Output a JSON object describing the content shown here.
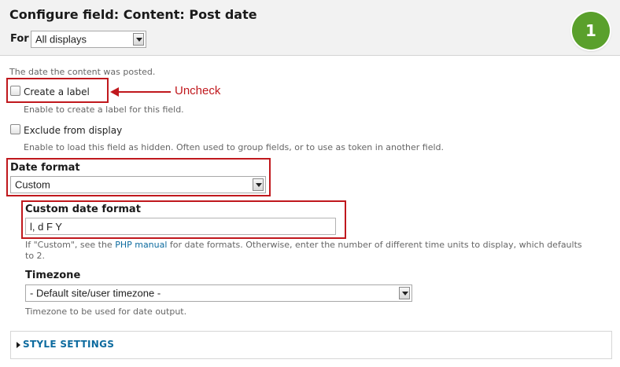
{
  "header": {
    "title": "Configure field: Content: Post date",
    "for_label": "For",
    "for_select_value": "All displays",
    "step_badge": "1"
  },
  "field": {
    "description": "The date the content was posted.",
    "create_label": {
      "label": "Create a label",
      "checked": false,
      "help": "Enable to create a label for this field."
    },
    "exclude": {
      "label": "Exclude from display",
      "checked": false,
      "help": "Enable to load this field as hidden. Often used to group fields, or to use as token in another field."
    },
    "date_format": {
      "label": "Date format",
      "value": "Custom"
    },
    "custom_date_format": {
      "label": "Custom date format",
      "value": "l, d F Y",
      "help_before": "If \"Custom\", see the ",
      "help_link": "PHP manual",
      "help_after": " for date formats. Otherwise, enter the number of different time units to display, which defaults",
      "help_line2": "to 2."
    },
    "timezone": {
      "label": "Timezone",
      "value": "- Default site/user timezone -",
      "help": "Timezone to be used for date output."
    }
  },
  "annotation": {
    "text": "Uncheck",
    "color": "#c0181d"
  },
  "style_settings": {
    "label": "STYLE SETTINGS"
  },
  "colors": {
    "badge": "#5aa02c",
    "link": "#0d6b9f",
    "highlight": "#c0181d"
  }
}
